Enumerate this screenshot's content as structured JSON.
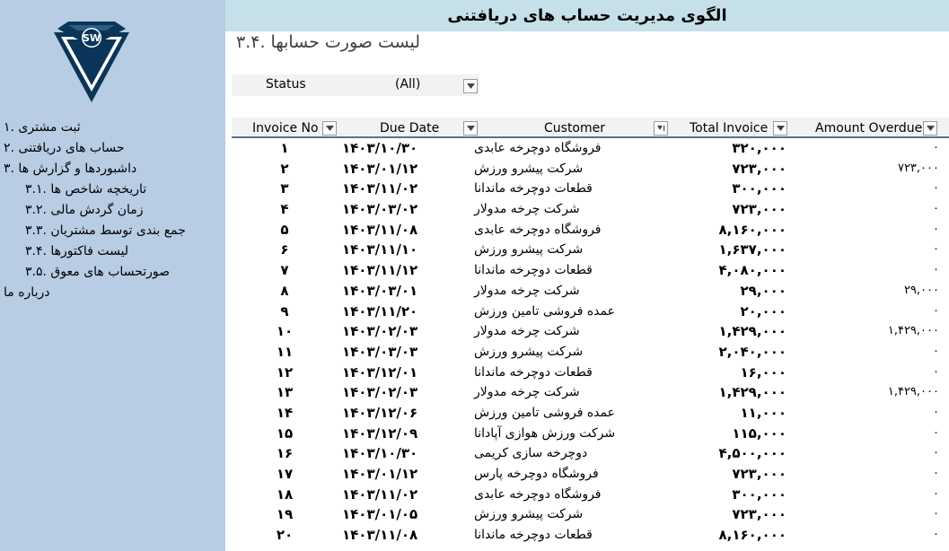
{
  "header": {
    "title": "الگوی مدیریت حساب های دریافتنی"
  },
  "page": {
    "subtitle": "لیست صورت حسابها .۳.۴"
  },
  "logo": {
    "text": "SW"
  },
  "colors": {
    "sidebar": "#b8cce4",
    "header": "#c6e0ea",
    "logo_dark": "#0b3558",
    "accent": "#5b6e9c"
  },
  "sidebar": {
    "items": [
      {
        "label": "ثبت مشتری .۱",
        "level": 1
      },
      {
        "label": "حساب های دریافتنی .۲",
        "level": 1
      },
      {
        "label": "داشبوردها و گزارش ها .۳",
        "level": 1
      },
      {
        "label": "تاریخچه شاخص ها .۳.۱",
        "level": 2
      },
      {
        "label": "زمان گردش مالی .۳.۲",
        "level": 2
      },
      {
        "label": "جمع بندی توسط مشتریان .۳.۳",
        "level": 2
      },
      {
        "label": "لیست فاکتورها .۳.۴",
        "level": 2
      },
      {
        "label": "صورتحساب های معوق .۳.۵",
        "level": 2
      },
      {
        "label": "درباره ما",
        "level": 1
      }
    ]
  },
  "filter": {
    "label": "Status",
    "value": "(All)",
    "icon": "dropdown-arrow-icon"
  },
  "table": {
    "columns": [
      "Invoice No",
      "Due Date",
      "Customer",
      "Total Invoice",
      "Amount Overdue"
    ],
    "rows": [
      [
        "۱",
        "۱۴۰۳/۱۰/۳۰",
        "فروشگاه دوچرخه عابدی",
        "۳۲۰,۰۰۰",
        "۰"
      ],
      [
        "۲",
        "۱۴۰۳/۰۱/۱۲",
        "شرکت پیشرو ورزش",
        "۷۲۳,۰۰۰",
        "۷۲۳,۰۰۰"
      ],
      [
        "۳",
        "۱۴۰۳/۱۱/۰۲",
        "قطعات دوچرخه ماندانا",
        "۳۰۰,۰۰۰",
        "۰"
      ],
      [
        "۴",
        "۱۴۰۳/۰۳/۰۲",
        "شرکت چرخه مدولار",
        "۷۲۳,۰۰۰",
        "۰"
      ],
      [
        "۵",
        "۱۴۰۳/۱۱/۰۸",
        "فروشگاه دوچرخه عابدی",
        "۸,۱۶۰,۰۰۰",
        "۰"
      ],
      [
        "۶",
        "۱۴۰۳/۱۱/۱۰",
        "شرکت پیشرو ورزش",
        "۱,۶۳۷,۰۰۰",
        "۰"
      ],
      [
        "۷",
        "۱۴۰۳/۱۱/۱۲",
        "قطعات دوچرخه ماندانا",
        "۴,۰۸۰,۰۰۰",
        "۰"
      ],
      [
        "۸",
        "۱۴۰۳/۰۳/۰۱",
        "شرکت چرخه مدولار",
        "۲۹,۰۰۰",
        "۲۹,۰۰۰"
      ],
      [
        "۹",
        "۱۴۰۳/۱۱/۲۰",
        "عمده فروشی تامین ورزش",
        "۲۰,۰۰۰",
        "۰"
      ],
      [
        "۱۰",
        "۱۴۰۳/۰۲/۰۳",
        "شرکت چرخه مدولار",
        "۱,۴۲۹,۰۰۰",
        "۱,۴۲۹,۰۰۰"
      ],
      [
        "۱۱",
        "۱۴۰۳/۰۳/۰۳",
        "شرکت پیشرو ورزش",
        "۲,۰۴۰,۰۰۰",
        "۰"
      ],
      [
        "۱۲",
        "۱۴۰۳/۱۲/۰۱",
        "قطعات دوچرخه ماندانا",
        "۱۶,۰۰۰",
        "۰"
      ],
      [
        "۱۳",
        "۱۴۰۳/۰۲/۰۳",
        "شرکت چرخه مدولار",
        "۱,۴۲۹,۰۰۰",
        "۱,۴۲۹,۰۰۰"
      ],
      [
        "۱۴",
        "۱۴۰۳/۱۲/۰۶",
        "عمده فروشی تامین ورزش",
        "۱۱,۰۰۰",
        "۰"
      ],
      [
        "۱۵",
        "۱۴۰۳/۱۲/۰۹",
        "شرکت ورزش هوازی آپادانا",
        "۱۱۵,۰۰۰",
        "۰"
      ],
      [
        "۱۶",
        "۱۴۰۳/۱۰/۳۰",
        "دوچرخه سازی کریمی",
        "۴,۵۰۰,۰۰۰",
        "۰"
      ],
      [
        "۱۷",
        "۱۴۰۳/۰۱/۱۲",
        "فروشگاه دوچرخه پارس",
        "۷۲۳,۰۰۰",
        "۰"
      ],
      [
        "۱۸",
        "۱۴۰۳/۱۱/۰۲",
        "فروشگاه دوچرخه عابدی",
        "۳۰۰,۰۰۰",
        "۰"
      ],
      [
        "۱۹",
        "۱۴۰۳/۰۱/۰۵",
        "شرکت پیشرو ورزش",
        "۷۲۳,۰۰۰",
        "۰"
      ],
      [
        "۲۰",
        "۱۴۰۳/۱۱/۰۸",
        "قطعات دوچرخه ماندانا",
        "۸,۱۶۰,۰۰۰",
        "۰"
      ]
    ]
  }
}
